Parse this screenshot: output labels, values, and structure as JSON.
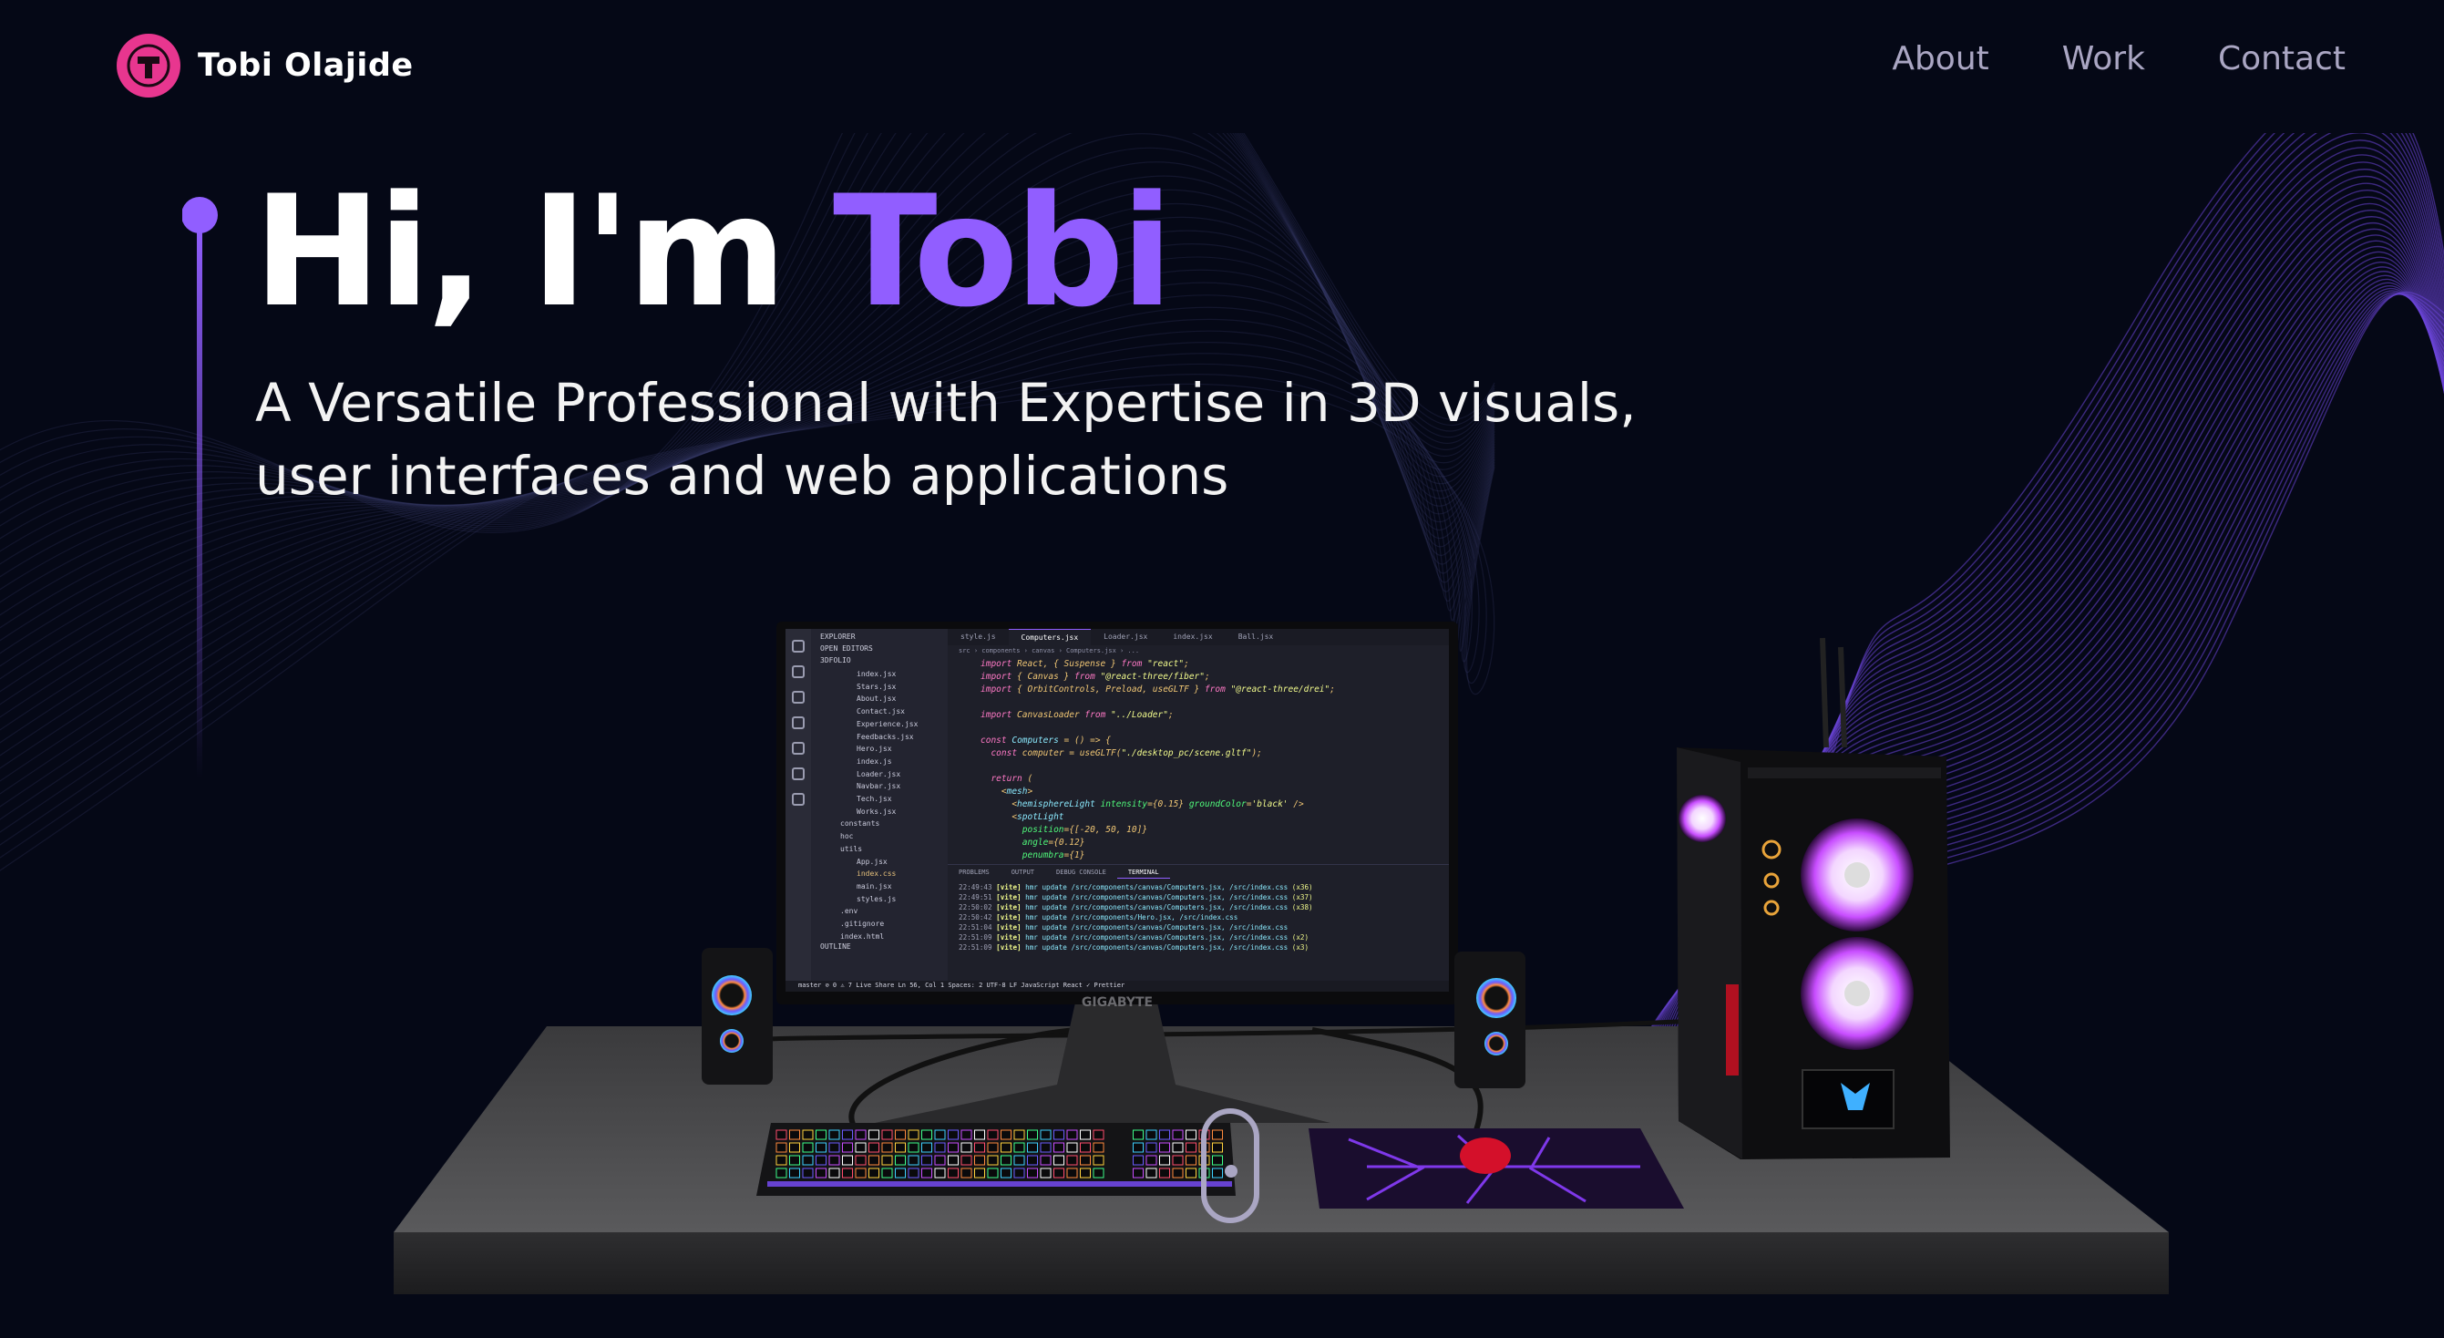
{
  "nav": {
    "brand_first": "Tobi",
    "brand_last": "Olajide",
    "logo_letter": "T",
    "links": [
      {
        "label": "About"
      },
      {
        "label": "Work"
      },
      {
        "label": "Contact"
      }
    ]
  },
  "hero": {
    "greeting": "Hi, I'm ",
    "name": "Tobi",
    "subtitle_line1": "A Versatile Professional with Expertise in 3D visuals,",
    "subtitle_line2": "user interfaces and web applications"
  },
  "monitor": {
    "brand": "GIGABYTE",
    "editor": {
      "explorer_title": "EXPLORER",
      "open_editors": "OPEN EDITORS",
      "project": "3DFOLIO",
      "files": [
        "index.jsx",
        "Stars.jsx",
        "About.jsx",
        "Contact.jsx",
        "Experience.jsx",
        "Feedbacks.jsx",
        "Hero.jsx",
        "index.js",
        "Loader.jsx",
        "Navbar.jsx",
        "Tech.jsx",
        "Works.jsx"
      ],
      "folders": [
        "constants",
        "hoc",
        "utils"
      ],
      "root_files": [
        "App.jsx",
        "index.css",
        "main.jsx",
        "styles.js",
        ".env",
        ".gitignore",
        "index.html"
      ],
      "outline": "OUTLINE",
      "tabs": [
        "style.js",
        "Computers.jsx",
        "Loader.jsx",
        "index.jsx",
        "Ball.jsx"
      ],
      "breadcrumb": "src › components › canvas › Computers.jsx › ...",
      "panel_tabs": [
        "PROBLEMS",
        "OUTPUT",
        "DEBUG CONSOLE",
        "TERMINAL"
      ],
      "status": "master  ⊘ 0 ⚠ 7   Live Share        Ln 56, Col 1   Spaces: 2   UTF-8   LF   JavaScript React   ✓ Prettier"
    }
  },
  "accent_color": "#915eff",
  "logo_color": "#e8368f",
  "background_color": "#050816"
}
